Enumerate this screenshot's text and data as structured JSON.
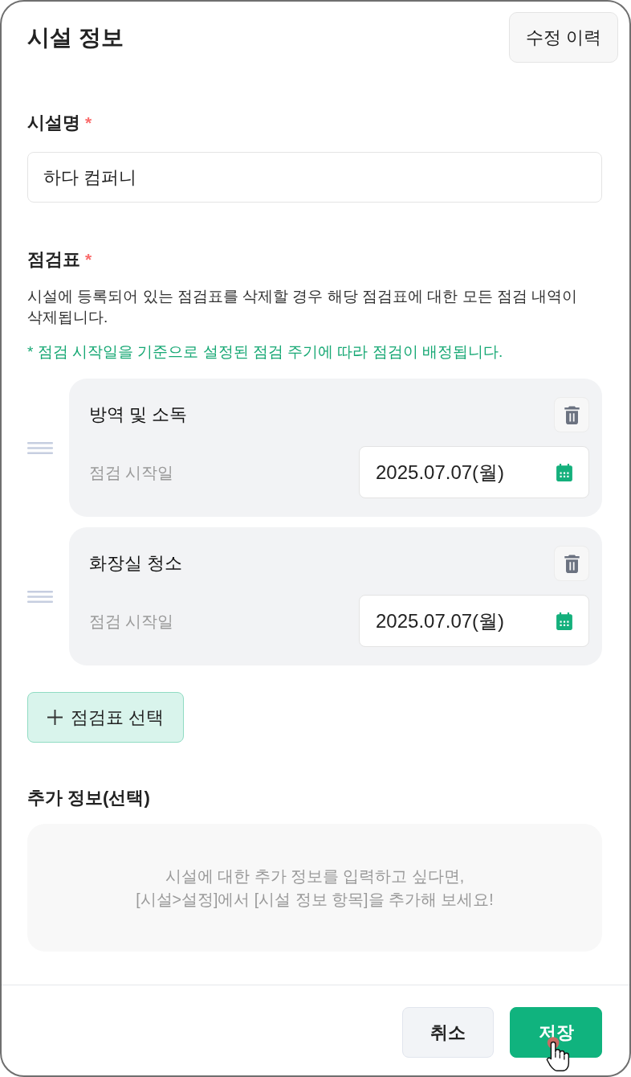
{
  "header": {
    "title": "시설 정보",
    "history_button": "수정 이력"
  },
  "facility_name": {
    "label": "시설명",
    "required_mark": "*",
    "value": "하다 컴퍼니"
  },
  "checklists": {
    "label": "점검표",
    "required_mark": "*",
    "description": "시설에 등록되어 있는 점검표를 삭제할 경우 해당 점검표에 대한 모든 점검 내역이 삭제됩니다.",
    "note": "* 점검 시작일을 기준으로 설정된 점검 주기에 따라 점검이 배정됩니다.",
    "items": [
      {
        "name": "방역 및 소독",
        "start_label": "점검 시작일",
        "start_date": "2025.07.07(월)"
      },
      {
        "name": "화장실 청소",
        "start_label": "점검 시작일",
        "start_date": "2025.07.07(월)"
      }
    ],
    "add_button": "점검표 선택"
  },
  "additional_info": {
    "label": "추가 정보(선택)",
    "message": "시설에 대한 추가 정보를 입력하고 싶다면,\n[시설>설정]에서 [시설 정보 항목]을 추가해 보세요!"
  },
  "footer": {
    "buttons": [
      {
        "label": "취소",
        "kind": "secondary"
      },
      {
        "label": "저장",
        "kind": "primary"
      }
    ]
  }
}
